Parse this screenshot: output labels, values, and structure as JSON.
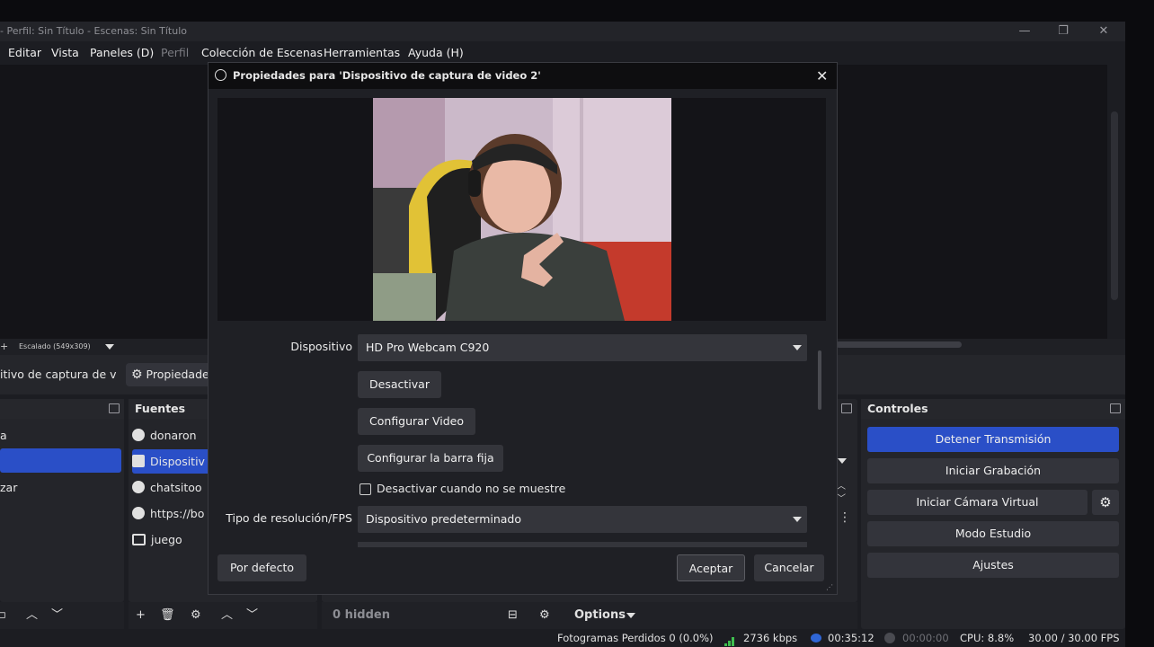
{
  "window": {
    "title": "- Perfil: Sin Título - Escenas: Sin Título",
    "min": "—",
    "max": "❐",
    "close": "✕"
  },
  "menubar": [
    "Editar",
    "Vista",
    "Paneles (D)",
    "Perfil",
    "Colección de Escenas",
    "Herramientas",
    "Ayuda (H)"
  ],
  "preview": {
    "scale_label": "Escalado (549x309)"
  },
  "source_bar": {
    "source_name": "itivo de captura de v",
    "properties_label": "Propiedades"
  },
  "scenes": {
    "items": [
      "a",
      "",
      "zar"
    ]
  },
  "sources": {
    "title": "Fuentes",
    "items": [
      "donaron",
      "Dispositiv",
      "chatsitoo",
      "https://bo",
      "juego"
    ]
  },
  "mixer": {
    "hidden_label": "0 hidden",
    "options_label": "Options"
  },
  "controls": {
    "title": "Controles",
    "stop_stream": "Detener Transmisión",
    "start_recording": "Iniciar Grabación",
    "start_virtual_cam": "Iniciar Cámara Virtual",
    "studio_mode": "Modo Estudio",
    "settings": "Ajustes"
  },
  "status": {
    "dropped_frames": "Fotogramas Perdidos 0 (0.0%)",
    "bitrate": "2736 kbps",
    "stream_time": "00:35:12",
    "rec_time": "00:00:00",
    "cpu": "CPU: 8.8%",
    "fps": "30.00 / 30.00 FPS"
  },
  "dialog": {
    "title": "Propiedades para 'Dispositivo de captura de video 2'",
    "device_label": "Dispositivo",
    "device_value": "HD Pro Webcam C920",
    "deactivate_label": "Desactivar",
    "configure_video_label": "Configurar Video",
    "configure_crossbar_label": "Configurar la barra fija",
    "deactivate_when_hidden_label": "Desactivar cuando no se muestre",
    "resolution_type_label": "Tipo de resolución/FPS",
    "resolution_type_value": "Dispositivo predeterminado",
    "defaults_label": "Por defecto",
    "ok_label": "Aceptar",
    "cancel_label": "Cancelar"
  },
  "colors": {
    "accent": "#2a4fc7",
    "panel": "#24252a",
    "dialog_bg": "#1f2025"
  }
}
